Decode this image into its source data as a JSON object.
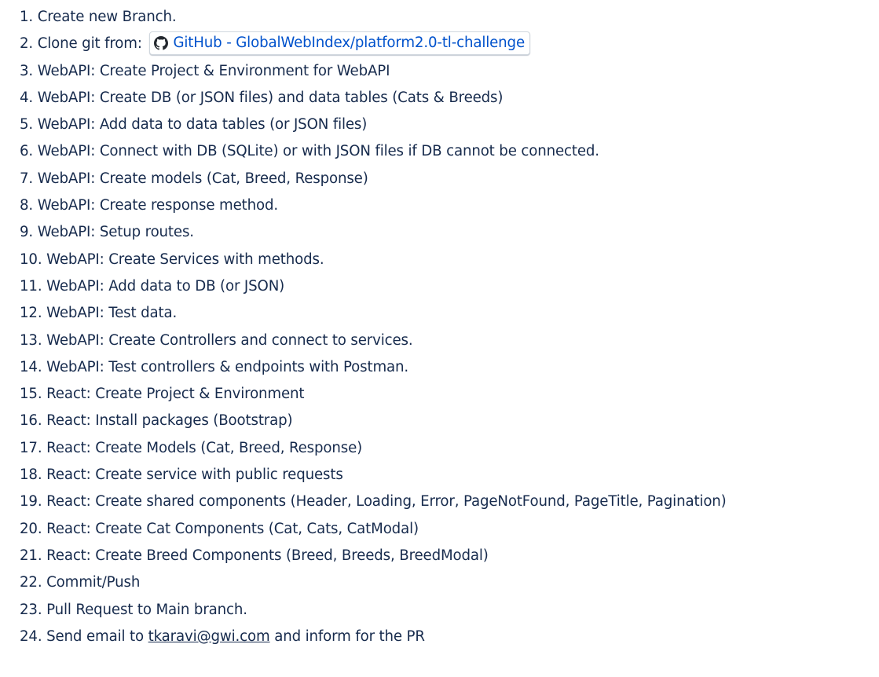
{
  "steps": [
    {
      "num": "1.",
      "text": "Create new Branch."
    },
    {
      "num": "2.",
      "prefix": "Clone git from:",
      "link": {
        "icon": "github-icon",
        "label": "GitHub - GlobalWebIndex/platform2.0-tl-challenge"
      }
    },
    {
      "num": "3.",
      "text": "WebAPI: Create Project & Environment for WebAPI"
    },
    {
      "num": "4.",
      "text": "WebAPI: Create DB (or JSON files) and data tables (Cats & Breeds)"
    },
    {
      "num": "5.",
      "text": "WebAPI: Add data to data tables (or JSON files)"
    },
    {
      "num": "6.",
      "text": "WebAPI: Connect with DB (SQLite) or with JSON files if DB cannot be connected."
    },
    {
      "num": "7.",
      "text": "WebAPI: Create models (Cat, Breed, Response)"
    },
    {
      "num": "8.",
      "text": "WebAPI: Create response method."
    },
    {
      "num": "9.",
      "text": "WebAPI: Setup routes."
    },
    {
      "num": "10.",
      "text": "WebAPI: Create Services with methods."
    },
    {
      "num": "11.",
      "text": "WebAPI: Add data to DB (or JSON)"
    },
    {
      "num": "12.",
      "text": "WebAPI: Test data."
    },
    {
      "num": "13.",
      "text": "WebAPI: Create Controllers and connect to services."
    },
    {
      "num": "14.",
      "text": "WebAPI: Test controllers & endpoints with Postman."
    },
    {
      "num": "15.",
      "text": "React: Create Project & Environment"
    },
    {
      "num": "16.",
      "text": "React: Install packages (Bootstrap)"
    },
    {
      "num": "17.",
      "text": "React: Create Models (Cat, Breed, Response)"
    },
    {
      "num": "18.",
      "text": "React: Create service with public requests"
    },
    {
      "num": "19.",
      "text": "React: Create shared components (Header, Loading, Error, PageNotFound, PageTitle, Pagination)"
    },
    {
      "num": "20.",
      "text": "React: Create Cat Components (Cat, Cats, CatModal)"
    },
    {
      "num": "21.",
      "text": "React: Create Breed Components (Breed, Breeds, BreedModal)"
    },
    {
      "num": "22.",
      "text": "Commit/Push"
    },
    {
      "num": "23.",
      "text": "Pull Request to Main branch."
    },
    {
      "num": "24.",
      "prefix": "Send email to",
      "email": "tkaravi@gwi.com",
      "suffix": "and inform for the PR"
    }
  ],
  "colors": {
    "text": "#172b4d",
    "link": "#0052cc"
  }
}
